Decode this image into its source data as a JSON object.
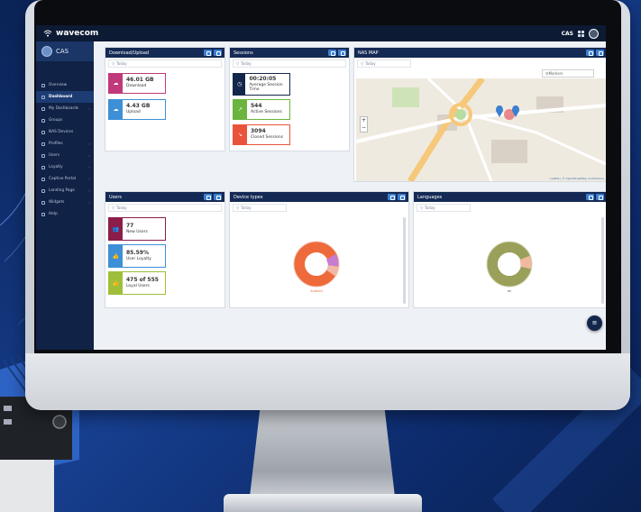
{
  "app": {
    "brand": "wavecom",
    "account": "CAS",
    "sidebar_title": "CAS"
  },
  "sidebar": {
    "items": [
      {
        "label": "Overview",
        "active": false,
        "chev": false
      },
      {
        "label": "Dashboard",
        "active": true,
        "chev": false
      },
      {
        "label": "My Dashboards",
        "active": false,
        "chev": true
      },
      {
        "label": "Groups",
        "active": false,
        "chev": false
      },
      {
        "label": "NAS Devices",
        "active": false,
        "chev": false
      },
      {
        "label": "Profiles",
        "active": false,
        "chev": true
      },
      {
        "label": "Users",
        "active": false,
        "chev": true
      },
      {
        "label": "Loyalty",
        "active": false,
        "chev": true
      },
      {
        "label": "Captive Portal",
        "active": false,
        "chev": true
      },
      {
        "label": "Landing Page",
        "active": false,
        "chev": true
      },
      {
        "label": "Widgets",
        "active": false,
        "chev": true
      },
      {
        "label": "Help",
        "active": false,
        "chev": false
      }
    ]
  },
  "filter_label": "Today",
  "panels": {
    "download_upload": {
      "title": "Download/Upload",
      "stats": [
        {
          "value": "46.01 GB",
          "label": "Download",
          "color": "#c0397a"
        },
        {
          "value": "4.43 GB",
          "label": "Upload",
          "color": "#3d8fd6"
        }
      ]
    },
    "sessions": {
      "title": "Sessions",
      "stats": [
        {
          "value": "00:20:05",
          "label": "Average Session Time",
          "color": "#13264b"
        },
        {
          "value": "544",
          "label": "Active Sessions",
          "color": "#6bb43f"
        },
        {
          "value": "3094",
          "label": "Closed Sessions",
          "color": "#e9533b"
        }
      ]
    },
    "nas_map": {
      "title": "NAS MAP",
      "layers": "Markers",
      "attribution": "Leaflet | © OpenStreetMap contributors"
    },
    "users": {
      "title": "Users",
      "stats": [
        {
          "value": "77",
          "label": "New Users",
          "color": "#8b1d4a"
        },
        {
          "value": "85.59%",
          "label": "User Loyalty",
          "color": "#3d8fd6"
        },
        {
          "value": "475 of 555",
          "label": "Loyal Users",
          "color": "#9fbf3a"
        }
      ]
    },
    "device_types": {
      "title": "Device types",
      "center_label": "Android"
    },
    "languages": {
      "title": "Languages",
      "center_label": "en"
    }
  },
  "colors": {
    "accent": "#3b7fd1",
    "header": "#142a55",
    "sidebar": "#102245"
  }
}
